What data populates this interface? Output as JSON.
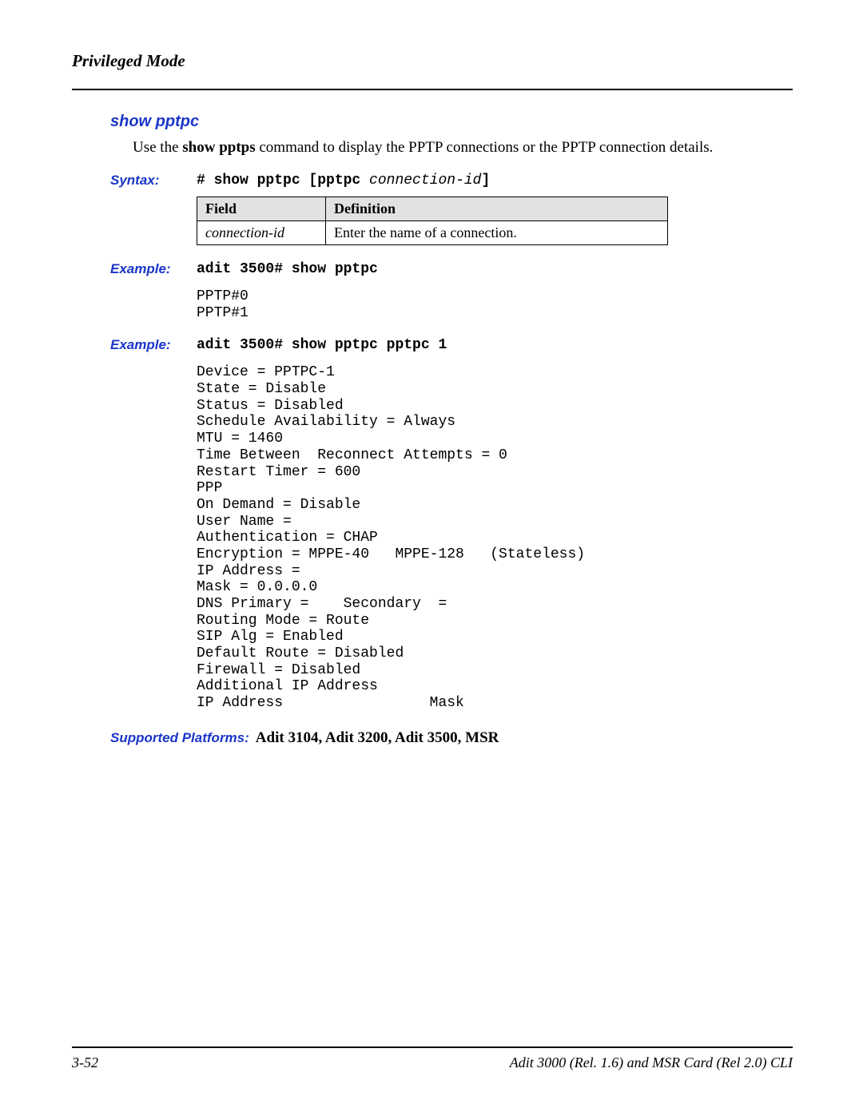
{
  "header": {
    "title": "Privileged Mode"
  },
  "section": {
    "heading": "show pptpc",
    "intro_prefix": "Use the ",
    "intro_bold": "show pptps",
    "intro_suffix": " command to display the PPTP connections or the PPTP connection details."
  },
  "syntax": {
    "label": "Syntax:",
    "prefix": "# show pptpc [pptpc ",
    "conn_id": "connection-id",
    "suffix": "]"
  },
  "table": {
    "headers": {
      "field": "Field",
      "definition": "Definition"
    },
    "row": {
      "field": "connection-id",
      "definition": "Enter the name of a connection."
    }
  },
  "example1": {
    "label": "Example:",
    "command": "adit 3500# show pptpc",
    "output": "PPTP#0\nPPTP#1"
  },
  "example2": {
    "label": "Example:",
    "command": "adit 3500# show pptpc pptpc 1",
    "output": "Device = PPTPC-1\nState = Disable\nStatus = Disabled\nSchedule Availability = Always\nMTU = 1460\nTime Between  Reconnect Attempts = 0\nRestart Timer = 600\nPPP\nOn Demand = Disable\nUser Name =\nAuthentication = CHAP\nEncryption = MPPE-40   MPPE-128   (Stateless)\nIP Address =\nMask = 0.0.0.0\nDNS Primary =    Secondary  =\nRouting Mode = Route\nSIP Alg = Enabled\nDefault Route = Disabled\nFirewall = Disabled\nAdditional IP Address\nIP Address                 Mask"
  },
  "platforms": {
    "label": "Supported Platforms:",
    "value": "Adit 3104, Adit 3200, Adit 3500, MSR"
  },
  "footer": {
    "left": "3-52",
    "right": "Adit 3000 (Rel. 1.6) and MSR Card (Rel 2.0) CLI"
  }
}
